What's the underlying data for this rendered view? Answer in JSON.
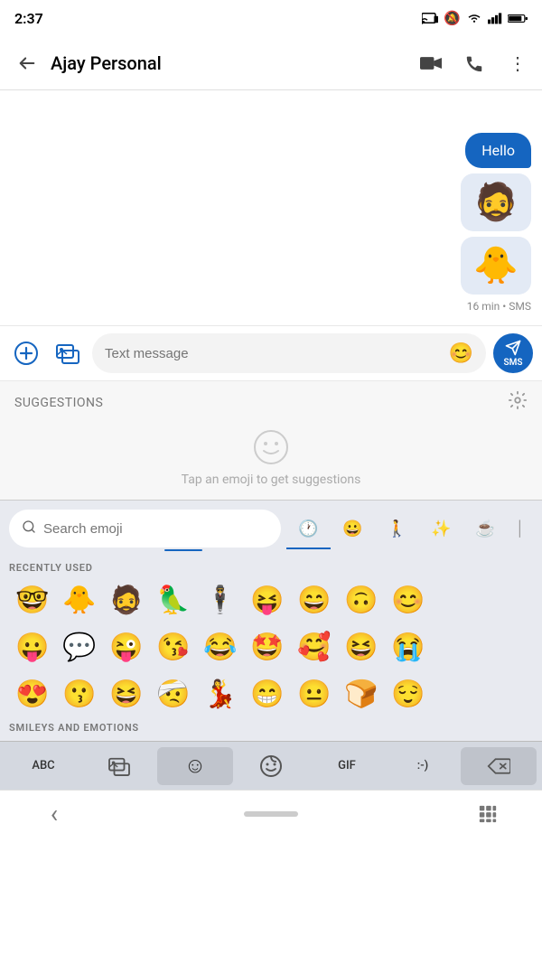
{
  "statusBar": {
    "time": "2:37",
    "icons": [
      "photo",
      "headset",
      "clipboard",
      "line",
      "dot"
    ]
  },
  "toolbar": {
    "title": "Ajay Personal",
    "backLabel": "←",
    "videoIcon": "📹",
    "phoneIcon": "📞",
    "moreIcon": "⋮"
  },
  "chat": {
    "messages": [
      {
        "text": "Hello",
        "type": "sent-text"
      },
      {
        "emoji": "🧔",
        "type": "sent-emoji"
      },
      {
        "emoji": "🐥",
        "type": "sent-emoji"
      }
    ],
    "timestamp": "16 min • SMS"
  },
  "inputBar": {
    "placeholder": "Text message",
    "addIcon": "+",
    "galleryIcon": "🖼",
    "emojiIcon": "😊",
    "sendLabel": "SMS"
  },
  "suggestions": {
    "label": "Suggestions",
    "hint": "Tap an emoji to get suggestions",
    "settingsIcon": "⚙"
  },
  "emojiKeyboard": {
    "searchPlaceholder": "Search emoji",
    "categories": [
      {
        "id": "recent",
        "icon": "🕐",
        "active": true
      },
      {
        "id": "smiley",
        "icon": "😀",
        "active": false
      },
      {
        "id": "people",
        "icon": "🚶",
        "active": false
      },
      {
        "id": "objects",
        "icon": "✨",
        "active": false
      },
      {
        "id": "food",
        "icon": "☕",
        "active": false
      }
    ],
    "sectionLabel": "RECENTLY USED",
    "sectionLabel2": "SMILEYS AND EMOTIONS",
    "recentEmojis": [
      [
        "🤓",
        "🐥",
        "🧔",
        "🦜",
        "🕴️",
        "😝",
        "😄",
        "🙃",
        "😊"
      ],
      [
        "😛",
        "💬",
        "😜",
        "😘",
        "😂",
        "🤩",
        "🥰",
        "😆",
        "😭"
      ],
      [
        "😍",
        "😗",
        "😆",
        "🤕",
        "💃",
        "😁",
        "😐",
        "🍞",
        "😌"
      ]
    ]
  },
  "keyboardBar": {
    "abc": "ABC",
    "galleryLabel": "🖼",
    "emojiLabel": "☺",
    "stickerLabel": "😊",
    "gifLabel": "GIF",
    "kaomoji": ":-)",
    "delete": "⌫"
  },
  "navBar": {
    "backIcon": "‹",
    "homeHandle": "",
    "gridIcon": "⠿"
  }
}
